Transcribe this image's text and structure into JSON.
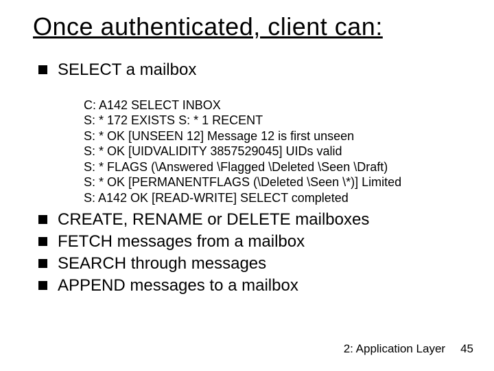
{
  "title": "Once authenticated, client can:",
  "bullets": {
    "b0": "SELECT a mailbox",
    "b1": "CREATE, RENAME or DELETE mailboxes",
    "b2": "FETCH messages from a mailbox",
    "b3": "SEARCH through messages",
    "b4": "APPEND messages to a mailbox"
  },
  "imap": {
    "l0": "C: A142 SELECT INBOX",
    "l1": "S: * 172 EXISTS S: * 1 RECENT",
    "l2": "S: * OK [UNSEEN 12] Message 12 is first unseen",
    "l3": "S: * OK [UIDVALIDITY 3857529045] UIDs valid",
    "l4": "S: * FLAGS (\\Answered \\Flagged \\Deleted \\Seen \\Draft)",
    "l5": "S: * OK [PERMANENTFLAGS (\\Deleted \\Seen \\*)] Limited",
    "l6": "S: A142 OK [READ-WRITE] SELECT completed"
  },
  "footer": {
    "chapter": "2: Application Layer",
    "page": "45"
  }
}
